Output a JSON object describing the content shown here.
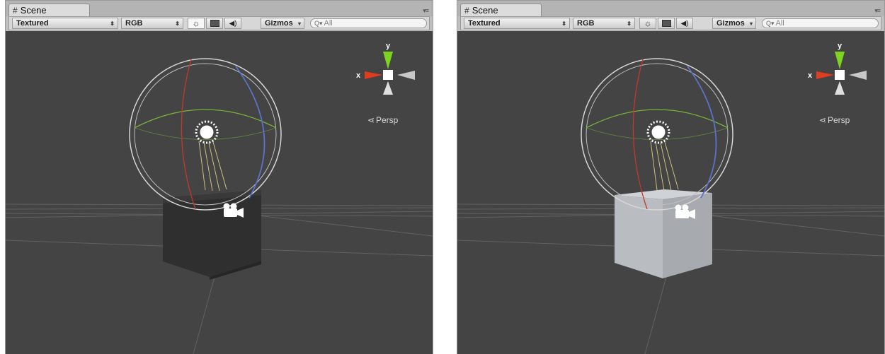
{
  "panels": [
    {
      "tab_label": "Scene",
      "tab_menu": "▾≡",
      "render_mode": "Textured",
      "color_mode": "RGB",
      "gizmos_label": "Gizmos",
      "search_placeholder": "All",
      "view_label": "Persp",
      "axis_y": "y",
      "axis_x": "x",
      "cube_state": "unlit-dark"
    },
    {
      "tab_label": "Scene",
      "tab_menu": "▾≡",
      "render_mode": "Textured",
      "color_mode": "RGB",
      "gizmos_label": "Gizmos",
      "search_placeholder": "All",
      "view_label": "Persp",
      "axis_y": "y",
      "axis_x": "x",
      "cube_state": "lit-light"
    }
  ],
  "colors": {
    "viewport_bg": "#444444",
    "cube_dark_front": "#2e2e2e",
    "cube_dark_side": "#262626",
    "cube_light_front": "#b9bcc1",
    "cube_light_side": "#a5a8ad",
    "axis_y": "#7ed321",
    "axis_x": "#e03c1e"
  },
  "icons": [
    "scene-icon",
    "lighting-icon",
    "image-icon",
    "audio-icon",
    "search-icon",
    "camera-gizmo-icon",
    "light-gizmo-icon"
  ]
}
